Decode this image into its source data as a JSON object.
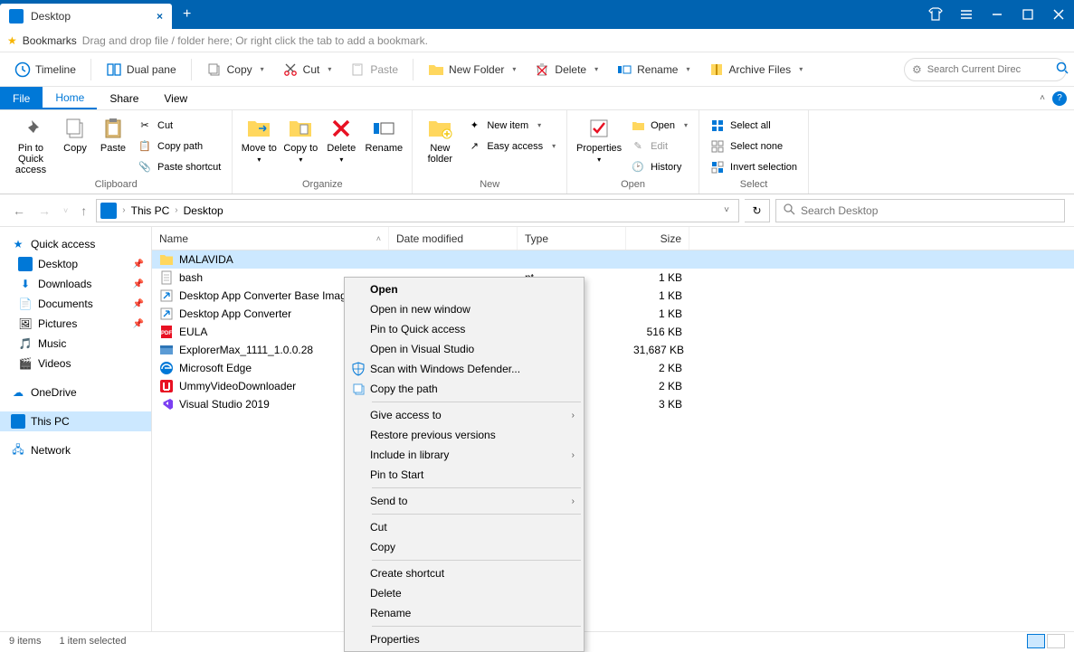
{
  "titlebar": {
    "tab_label": "Desktop"
  },
  "bookmarks": {
    "label": "Bookmarks",
    "hint": "Drag and drop file / folder here; Or right click the tab to add a bookmark."
  },
  "toolbar": {
    "timeline": "Timeline",
    "dualpane": "Dual pane",
    "copy": "Copy",
    "cut": "Cut",
    "paste": "Paste",
    "newfolder": "New Folder",
    "delete": "Delete",
    "rename": "Rename",
    "archive": "Archive Files",
    "search_placeholder": "Search Current Direc"
  },
  "ribtabs": {
    "file": "File",
    "home": "Home",
    "share": "Share",
    "view": "View"
  },
  "ribbon": {
    "pin": "Pin to Quick access",
    "copy": "Copy",
    "paste": "Paste",
    "cut": "Cut",
    "copypath": "Copy path",
    "pasteshortcut": "Paste shortcut",
    "clipboard": "Clipboard",
    "moveto": "Move to",
    "copyto": "Copy to",
    "delete": "Delete",
    "rename": "Rename",
    "organize": "Organize",
    "newfolder": "New folder",
    "newitem": "New item",
    "easyaccess": "Easy access",
    "new": "New",
    "properties": "Properties",
    "open": "Open",
    "edit": "Edit",
    "history": "History",
    "opengrp": "Open",
    "selectall": "Select all",
    "selectnone": "Select none",
    "invert": "Invert selection",
    "select": "Select"
  },
  "breadcrumb": {
    "pc": "This PC",
    "loc": "Desktop"
  },
  "search2": {
    "placeholder": "Search Desktop"
  },
  "headers": {
    "name": "Name",
    "date": "Date modified",
    "type": "Type",
    "size": "Size"
  },
  "sidebar": {
    "quick": "Quick access",
    "desktop": "Desktop",
    "downloads": "Downloads",
    "documents": "Documents",
    "pictures": "Pictures",
    "music": "Music",
    "videos": "Videos",
    "onedrive": "OneDrive",
    "thispc": "This PC",
    "network": "Network"
  },
  "files": [
    {
      "name": "MALAVIDA",
      "type": "",
      "size": "",
      "icon": "folder"
    },
    {
      "name": "bash",
      "type": "nt",
      "size": "1 KB",
      "icon": "file"
    },
    {
      "name": "Desktop App Converter Base Imag",
      "type": "rtcut",
      "size": "1 KB",
      "icon": "shortcut"
    },
    {
      "name": "Desktop App Converter",
      "type": "rtcut",
      "size": "1 KB",
      "icon": "shortcut"
    },
    {
      "name": "EULA",
      "type": "",
      "size": "516 KB",
      "icon": "pdf"
    },
    {
      "name": "ExplorerMax_1111_1.0.0.28",
      "type": "",
      "size": "31,687 KB",
      "icon": "exe"
    },
    {
      "name": "Microsoft Edge",
      "type": "",
      "size": "2 KB",
      "icon": "edge"
    },
    {
      "name": "UmmyVideoDownloader",
      "type": "",
      "size": "2 KB",
      "icon": "ummy"
    },
    {
      "name": "Visual Studio 2019",
      "type": "",
      "size": "3 KB",
      "icon": "vs"
    }
  ],
  "context": {
    "open": "Open",
    "open_new": "Open in new window",
    "pin_quick": "Pin to Quick access",
    "open_vs": "Open in Visual Studio",
    "scan": "Scan with Windows Defender...",
    "copypath": "Copy the path",
    "give": "Give access to",
    "restore": "Restore previous versions",
    "include": "Include in library",
    "pin_start": "Pin to Start",
    "sendto": "Send to",
    "cut": "Cut",
    "copy": "Copy",
    "shortcut": "Create shortcut",
    "delete": "Delete",
    "rename": "Rename",
    "properties": "Properties"
  },
  "status": {
    "items": "9 items",
    "selected": "1 item selected"
  }
}
